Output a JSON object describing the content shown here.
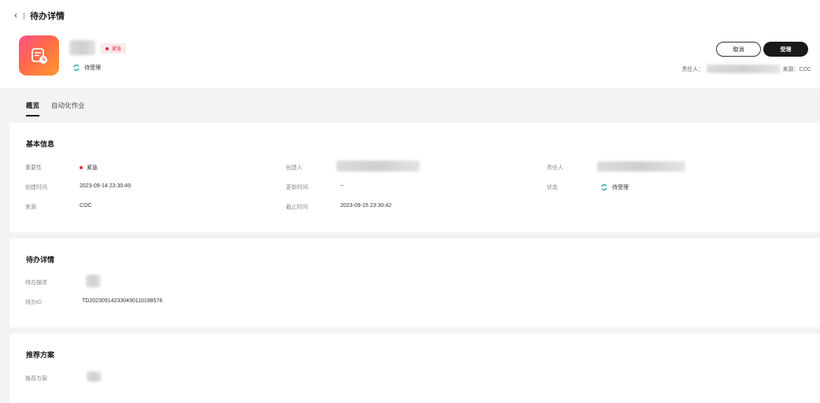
{
  "header": {
    "title": "待办详情",
    "urgency_badge": "紧急",
    "status": "待受理",
    "cancel_label": "取消",
    "accept_label": "受理",
    "assignee_label": "责任人：",
    "source_text": "来源：COC"
  },
  "tabs": [
    {
      "label": "概览",
      "active": true
    },
    {
      "label": "自动化作业",
      "active": false
    }
  ],
  "basic_info": {
    "title": "基本信息",
    "importance_label": "重要性",
    "importance_value": "紧急",
    "creator_label": "创建人",
    "assignee_label": "责任人",
    "created_time_label": "创建时间",
    "created_time_value": "2023-09-14 23:30:49",
    "updated_time_label": "更新时间",
    "updated_time_value": "--",
    "status_label": "状态",
    "status_value": "待受理",
    "source_label": "来源",
    "source_value": "COC",
    "deadline_label": "截止时间",
    "deadline_value": "2023-09-15 23:30:42"
  },
  "todo_details": {
    "title": "待办详情",
    "description_label": "待办描述",
    "id_label": "待办ID",
    "id_value": "TD202309142330490110198576"
  },
  "recommendation": {
    "title": "推荐方案",
    "plan_label": "推荐方案"
  },
  "colors": {
    "urgent": "#e02c3a",
    "status_teal": "#12a3a3",
    "primary": "#191919"
  }
}
